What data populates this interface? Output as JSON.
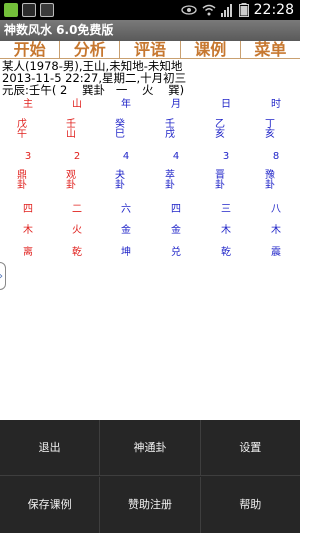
{
  "status": {
    "time": "22:28",
    "icons": [
      "messenger-icon",
      "image-icon",
      "photo-icon",
      "eye-icon",
      "wifi-icon",
      "signal-icon",
      "battery-icon"
    ]
  },
  "app": {
    "title": "神数风水 6.0免费版"
  },
  "top_menu": [
    {
      "label": "开始"
    },
    {
      "label": "分析"
    },
    {
      "label": "评语"
    },
    {
      "label": "课例"
    },
    {
      "label": "菜单"
    }
  ],
  "info": {
    "line1": "某人(1978-男),王山,未知地-未知地",
    "line2": "2013-11-5 22:27,星期二,十月初三",
    "line3": "元辰:壬午( 2    巽卦   一    火    巽)"
  },
  "table": {
    "headers": [
      "主",
      "山",
      "年",
      "月",
      "日",
      "时"
    ],
    "r1": [
      "戊午",
      "壬山",
      "癸巳",
      "壬戌",
      "乙亥",
      "丁亥"
    ],
    "r2": [
      "3",
      "2",
      "4",
      "4",
      "3",
      "8"
    ],
    "r3": [
      "鼎卦",
      "观卦",
      "夬卦",
      "萃卦",
      "晋卦",
      "豫卦"
    ],
    "r4": [
      "四",
      "二",
      "六",
      "四",
      "三",
      "八"
    ],
    "r5": [
      "木",
      "火",
      "金",
      "金",
      "木",
      "木"
    ],
    "r6": [
      "离",
      "乾",
      "坤",
      "兑",
      "乾",
      "震"
    ]
  },
  "bottom_menu": {
    "row1": [
      "退出",
      "神通卦",
      "设置"
    ],
    "row2": [
      "保存课例",
      "赞助注册",
      "帮助"
    ]
  },
  "colors": {
    "accent_orange": "#c77830",
    "red": "#e0211e",
    "blue": "#2025c8"
  }
}
